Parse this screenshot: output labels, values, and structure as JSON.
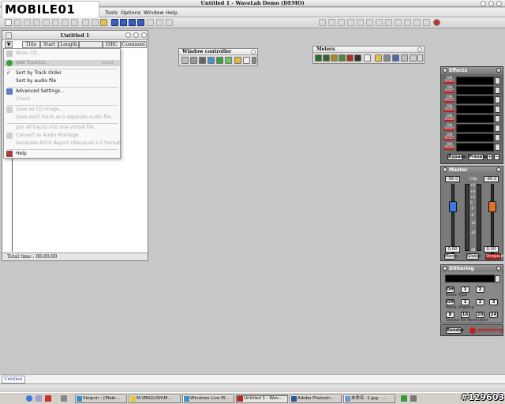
{
  "app": {
    "title": "Untitled 1 - WaveLab Demo (DEMO)",
    "logo_text": "MOBILE01"
  },
  "menubar": {
    "items": [
      "Tools",
      "Options",
      "Window",
      "Help"
    ]
  },
  "document": {
    "title": "Untitled 1",
    "columns": [
      "Title",
      "Start",
      "Length",
      "",
      "ISRC",
      "Comment"
    ],
    "status": "Total time : 00:00:00",
    "tab_label": "Untitled 1"
  },
  "dropdown": {
    "items": [
      {
        "label": "Write CD...",
        "shortcut": "",
        "enabled": false
      },
      {
        "label": "Add Track(s)...",
        "shortcut": "Insert",
        "enabled": true,
        "highlighted": true
      },
      {
        "label": "Sort by Track Order",
        "shortcut": "",
        "enabled": true,
        "checked": true
      },
      {
        "label": "Sort by audio file",
        "shortcut": "",
        "enabled": true
      },
      {
        "label": "Advanced Settings...",
        "shortcut": "",
        "enabled": true
      },
      {
        "label": "Check",
        "shortcut": "",
        "enabled": false
      },
      {
        "label": "Save as CD image...",
        "shortcut": "",
        "enabled": false
      },
      {
        "label": "Save each track as a separate audio file...",
        "shortcut": "",
        "enabled": false
      },
      {
        "label": "Join all tracks into one virtual file...",
        "shortcut": "",
        "enabled": false
      },
      {
        "label": "Convert as Audio Montage",
        "shortcut": "",
        "enabled": false
      },
      {
        "label": "Generate ASCII Report (WaveLab 5.0 format)",
        "shortcut": "",
        "enabled": false
      },
      {
        "label": "Help",
        "shortcut": "",
        "enabled": true
      }
    ]
  },
  "palettes": {
    "window_controller": "Window controller",
    "meters": "Meters"
  },
  "effects": {
    "title": "Effects",
    "slot_on": "ON",
    "slot_solo": "SOLO",
    "bypass": "Bypass",
    "presets": "Presets"
  },
  "master": {
    "title": "Master",
    "left_db": "-96.0",
    "right_db": "-96.0",
    "clip": "Clip",
    "left_gain": "0.00",
    "right_gain": "0.00",
    "db_label": "dB",
    "scale": [
      "+6",
      "+4",
      "+2",
      "0",
      "-2",
      "-6",
      "-12",
      "-24"
    ],
    "mono": "Mono",
    "global": "Global",
    "dropout": "Dropout"
  },
  "dithering": {
    "title": "Dithering",
    "noise_type": "Noise Type",
    "noise_shaping": "Noise Shaping",
    "output_bit_resolution": "Output Bit Resolution",
    "off": "Off",
    "options_a": [
      "1",
      "2"
    ],
    "options_b": [
      "1",
      "2",
      "3"
    ],
    "bits": [
      "8",
      "16",
      "20",
      "24"
    ]
  },
  "render": {
    "label": "Render",
    "brand": "steinberg"
  },
  "taskbar": {
    "items": [
      "Sleipnir - [Mobi...",
      "M:\\ENGLISH\\M...",
      "Windows Live M...",
      "Untitled 1 - Wav...",
      "Adobe Photosh...",
      "未命名 -1.jpg - ..."
    ],
    "active_index": 3
  },
  "watermark": "#129603"
}
